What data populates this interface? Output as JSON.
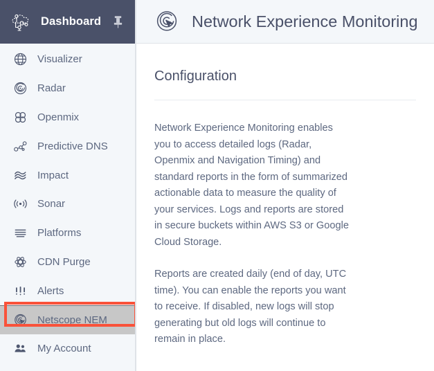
{
  "sidebar": {
    "brand": {
      "label": "Dashboard",
      "icon": "cloud-network-icon"
    },
    "pin": {
      "icon": "pin-icon",
      "label": "Pin sidebar"
    },
    "items": [
      {
        "label": "Visualizer",
        "icon": "globe-icon",
        "selected": false
      },
      {
        "label": "Radar",
        "icon": "radar-icon",
        "selected": false
      },
      {
        "label": "Openmix",
        "icon": "four-circles-icon",
        "selected": false
      },
      {
        "label": "Predictive DNS",
        "icon": "nodes-graph-icon",
        "selected": false
      },
      {
        "label": "Impact",
        "icon": "waves-icon",
        "selected": false
      },
      {
        "label": "Sonar",
        "icon": "sonar-signal-icon",
        "selected": false
      },
      {
        "label": "Platforms",
        "icon": "stacked-lines-icon",
        "selected": false
      },
      {
        "label": "CDN Purge",
        "icon": "atom-icon",
        "selected": false
      },
      {
        "label": "Alerts",
        "icon": "alert-bars-icon",
        "selected": false
      },
      {
        "label": "Netscope NEM",
        "icon": "nem-cursor-icon",
        "selected": true
      },
      {
        "label": "My Account",
        "icon": "people-icon",
        "selected": false
      }
    ]
  },
  "header": {
    "title": "Network Experience Monitoring",
    "icon": "nem-cursor-icon"
  },
  "main": {
    "section_title": "Configuration",
    "paragraphs": [
      "Network Experience Monitoring enables you to access detailed logs (Radar, Openmix and Navigation Timing) and standard reports in the form of summarized actionable data to measure the quality of your services. Logs and reports are stored in secure buckets within AWS S3 or Google Cloud Storage.",
      "Reports are created daily (end of day, UTC time). You can enable the reports you want to receive. If disabled, new logs will stop generating but old logs will continue to remain in place."
    ]
  },
  "colors": {
    "sidebar_header_bg": "#4a5169",
    "sidebar_bg": "#f4f7fa",
    "text": "#5d6880",
    "title": "#4a5169",
    "selected_row_bg": "#c7c7c7",
    "annotation": "#f9523a"
  }
}
